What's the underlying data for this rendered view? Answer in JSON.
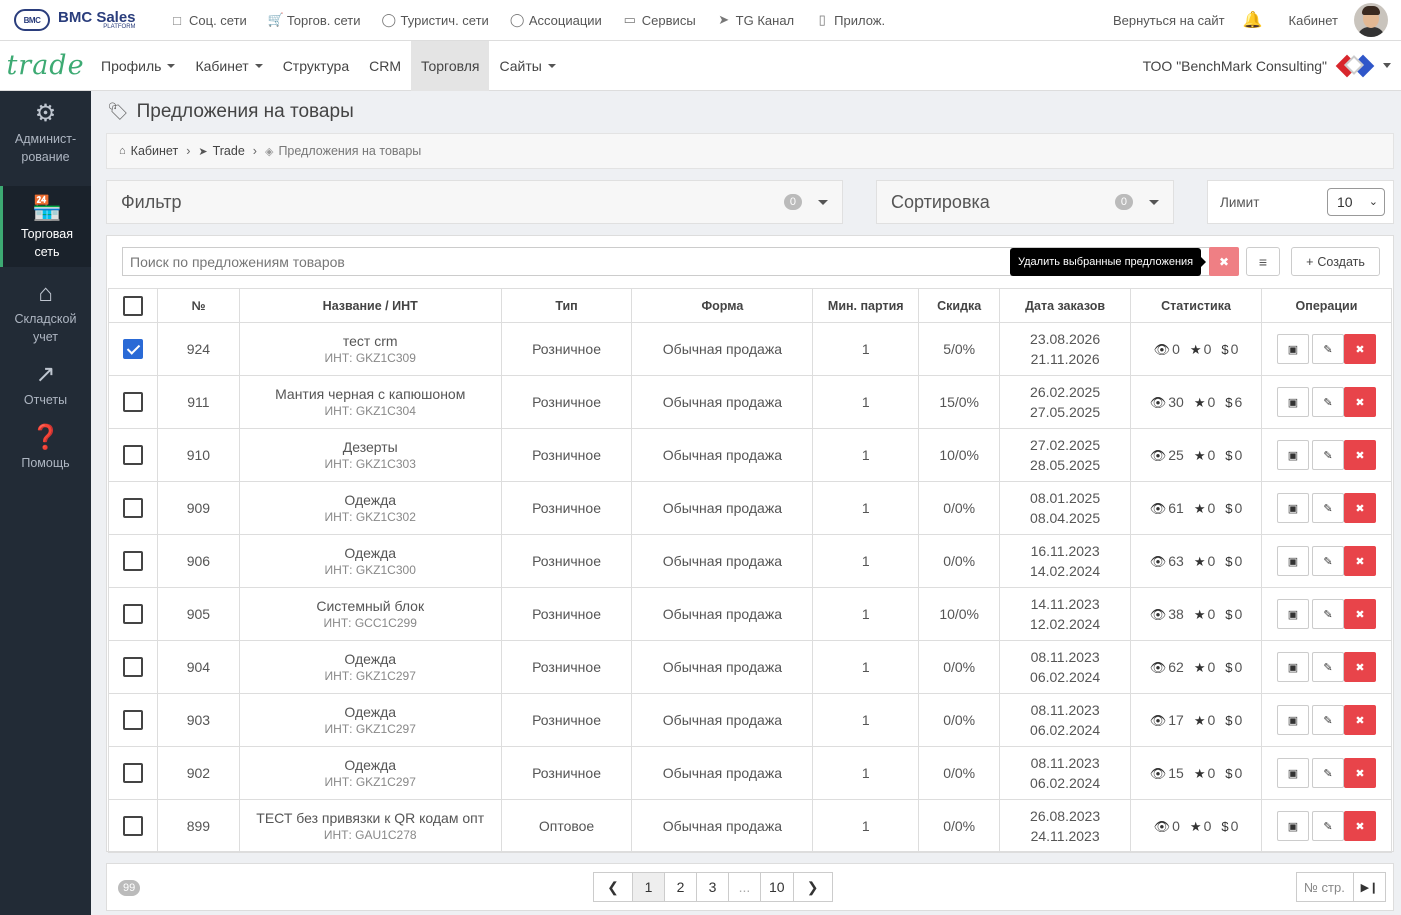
{
  "logo": {
    "name": "BMC Sales",
    "sub": "PLATFORM",
    "mark": "BMC"
  },
  "topnav": [
    {
      "label": "Соц. сети",
      "icon": "chat-icon"
    },
    {
      "label": "Торгов. сети",
      "icon": "cart-icon"
    },
    {
      "label": "Туристич. сети",
      "icon": "globe-icon"
    },
    {
      "label": "Ассоциации",
      "icon": "network-icon"
    },
    {
      "label": "Сервисы",
      "icon": "box-icon"
    },
    {
      "label": "TG Канал",
      "icon": "telegram-icon"
    },
    {
      "label": "Прилож.",
      "icon": "phone-icon"
    }
  ],
  "topright": {
    "back": "Вернуться на сайт",
    "cabinet": "Кабинет"
  },
  "brand": "trade",
  "mainnav": [
    {
      "label": "Профиль",
      "dropdown": true,
      "active": false
    },
    {
      "label": "Кабинет",
      "dropdown": true,
      "active": false
    },
    {
      "label": "Структура",
      "dropdown": false,
      "active": false
    },
    {
      "label": "CRM",
      "dropdown": false,
      "active": false
    },
    {
      "label": "Торговля",
      "dropdown": false,
      "active": true
    },
    {
      "label": "Сайты",
      "dropdown": true,
      "active": false
    }
  ],
  "company": "ТОО \"BenchMark Consulting\"",
  "sidebar": [
    {
      "label": "Админист-рование",
      "icon": "gears-icon",
      "active": false
    },
    {
      "label": "Торговая сеть",
      "icon": "store-icon",
      "active": true
    },
    {
      "label": "Складской учет",
      "icon": "warehouse-icon",
      "active": false
    },
    {
      "label": "Отчеты",
      "icon": "share-icon",
      "active": false
    },
    {
      "label": "Помощь",
      "icon": "help-icon",
      "active": false
    }
  ],
  "page": {
    "title": "Предложения на товары"
  },
  "breadcrumb": {
    "home": "Кабинет",
    "trade": "Trade",
    "current": "Предложения на товары"
  },
  "filter": {
    "label": "Фильтр",
    "count": "0"
  },
  "sort": {
    "label": "Сортировка",
    "count": "0"
  },
  "limit": {
    "label": "Лимит",
    "value": "10"
  },
  "search": {
    "placeholder": "Поиск по предложениям товаров"
  },
  "toolbar": {
    "delete_tooltip": "Удалить выбранные предложения",
    "create_label": "Создать"
  },
  "table": {
    "headers": [
      "№",
      "Название / ИНТ",
      "Тип",
      "Форма",
      "Мин. партия",
      "Скидка",
      "Дата заказов",
      "Статистика",
      "Операции"
    ],
    "rows": [
      {
        "checked": true,
        "id": "924",
        "name": "тест crm",
        "int": "ИНТ: GKZ1C309",
        "type": "Розничное",
        "form": "Обычная продажа",
        "min": "1",
        "discount": "5/0%",
        "d1": "23.08.2026",
        "d2": "21.11.2026",
        "views": "0",
        "stars": "0",
        "money": "0"
      },
      {
        "checked": false,
        "id": "911",
        "name": "Мантия черная с капюшоном",
        "int": "ИНТ: GKZ1C304",
        "type": "Розничное",
        "form": "Обычная продажа",
        "min": "1",
        "discount": "15/0%",
        "d1": "26.02.2025",
        "d2": "27.05.2025",
        "views": "30",
        "stars": "0",
        "money": "6"
      },
      {
        "checked": false,
        "id": "910",
        "name": "Дезерты",
        "int": "ИНТ: GKZ1C303",
        "type": "Розничное",
        "form": "Обычная продажа",
        "min": "1",
        "discount": "10/0%",
        "d1": "27.02.2025",
        "d2": "28.05.2025",
        "views": "25",
        "stars": "0",
        "money": "0"
      },
      {
        "checked": false,
        "id": "909",
        "name": "Одежда",
        "int": "ИНТ: GKZ1C302",
        "type": "Розничное",
        "form": "Обычная продажа",
        "min": "1",
        "discount": "0/0%",
        "d1": "08.01.2025",
        "d2": "08.04.2025",
        "views": "61",
        "stars": "0",
        "money": "0"
      },
      {
        "checked": false,
        "id": "906",
        "name": "Одежда",
        "int": "ИНТ: GKZ1C300",
        "type": "Розничное",
        "form": "Обычная продажа",
        "min": "1",
        "discount": "0/0%",
        "d1": "16.11.2023",
        "d2": "14.02.2024",
        "views": "63",
        "stars": "0",
        "money": "0"
      },
      {
        "checked": false,
        "id": "905",
        "name": "Системный блок",
        "int": "ИНТ: GCC1C299",
        "type": "Розничное",
        "form": "Обычная продажа",
        "min": "1",
        "discount": "10/0%",
        "d1": "14.11.2023",
        "d2": "12.02.2024",
        "views": "38",
        "stars": "0",
        "money": "0"
      },
      {
        "checked": false,
        "id": "904",
        "name": "Одежда",
        "int": "ИНТ: GKZ1C297",
        "type": "Розничное",
        "form": "Обычная продажа",
        "min": "1",
        "discount": "0/0%",
        "d1": "08.11.2023",
        "d2": "06.02.2024",
        "views": "62",
        "stars": "0",
        "money": "0"
      },
      {
        "checked": false,
        "id": "903",
        "name": "Одежда",
        "int": "ИНТ: GKZ1C297",
        "type": "Розничное",
        "form": "Обычная продажа",
        "min": "1",
        "discount": "0/0%",
        "d1": "08.11.2023",
        "d2": "06.02.2024",
        "views": "17",
        "stars": "0",
        "money": "0"
      },
      {
        "checked": false,
        "id": "902",
        "name": "Одежда",
        "int": "ИНТ: GKZ1C297",
        "type": "Розничное",
        "form": "Обычная продажа",
        "min": "1",
        "discount": "0/0%",
        "d1": "08.11.2023",
        "d2": "06.02.2024",
        "views": "15",
        "stars": "0",
        "money": "0"
      },
      {
        "checked": false,
        "id": "899",
        "name": "ТЕСТ без привязки к QR кодам опт",
        "int": "ИНТ: GAU1C278",
        "type": "Оптовое",
        "form": "Обычная продажа",
        "min": "1",
        "discount": "0/0%",
        "d1": "26.08.2023",
        "d2": "24.11.2023",
        "views": "0",
        "stars": "0",
        "money": "0"
      }
    ]
  },
  "pagination": {
    "total": "99",
    "pages": [
      "1",
      "2",
      "3",
      "...",
      "10"
    ],
    "current": "1",
    "page_input_placeholder": "№ стр."
  },
  "colors": {
    "accent": "#3daa73",
    "danger": "#e8444a",
    "sidebar": "#222b36",
    "checkbox": "#2a6ad6"
  }
}
